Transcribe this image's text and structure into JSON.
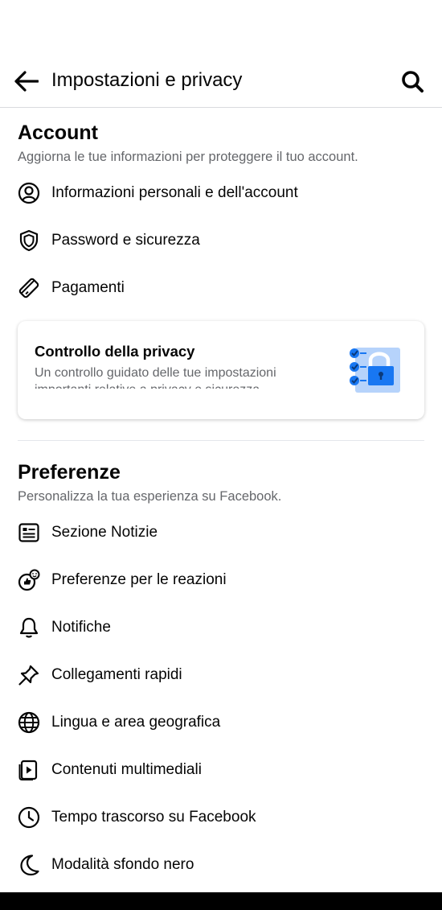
{
  "header": {
    "title": "Impostazioni e privacy"
  },
  "account": {
    "title": "Account",
    "subtitle": "Aggiorna le tue informazioni per proteggere il tuo account.",
    "items": [
      {
        "label": "Informazioni personali e dell'account",
        "icon": "profile-circle-icon"
      },
      {
        "label": "Password e sicurezza",
        "icon": "shield-icon"
      },
      {
        "label": "Pagamenti",
        "icon": "tag-icon"
      }
    ],
    "privacy_card": {
      "title": "Controllo della privacy",
      "description": "Un controllo guidato delle tue impostazioni importanti relative a privacy e sicurezza."
    }
  },
  "preferences": {
    "title": "Preferenze",
    "subtitle": "Personalizza la tua esperienza su Facebook.",
    "items": [
      {
        "label": "Sezione Notizie",
        "icon": "news-feed-icon"
      },
      {
        "label": "Preferenze per le reazioni",
        "icon": "reactions-icon"
      },
      {
        "label": "Notifiche",
        "icon": "bell-icon"
      },
      {
        "label": "Collegamenti rapidi",
        "icon": "pin-icon"
      },
      {
        "label": "Lingua e area geografica",
        "icon": "globe-icon"
      },
      {
        "label": "Contenuti multimediali",
        "icon": "media-icon"
      },
      {
        "label": "Tempo trascorso su Facebook",
        "icon": "clock-icon"
      },
      {
        "label": "Modalità sfondo nero",
        "icon": "moon-icon"
      }
    ]
  },
  "colors": {
    "accent": "#1877f2",
    "secondary_text": "#65676b"
  }
}
